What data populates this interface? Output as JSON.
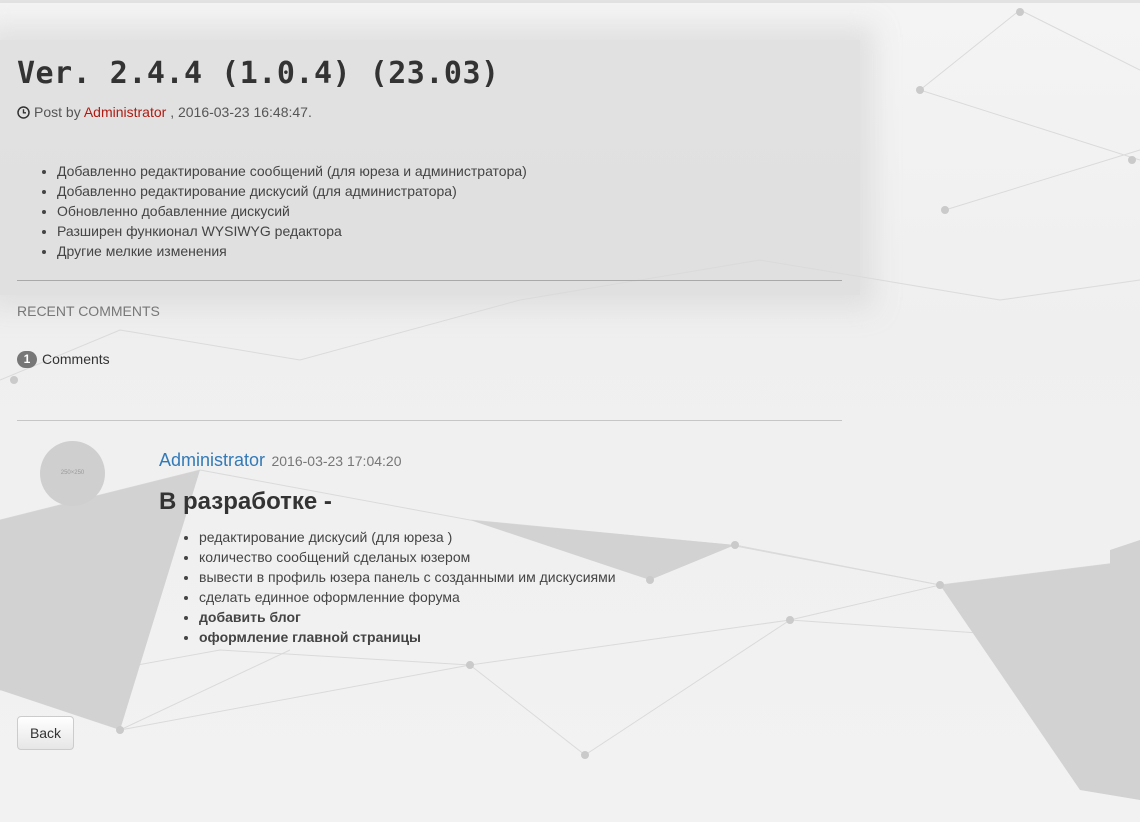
{
  "post": {
    "title": "Ver. 2.4.4 (1.0.4) (23.03)",
    "meta_prefix": "Post by",
    "author": "Administrator",
    "meta_suffix": ", 2016-03-23 16:48:47.",
    "changes": [
      "Добавленно редактирование сообщений (для юреза и администратора)",
      "Добавленно редактирование дискусий (для администратора)",
      "Обновленно добавленние дискусий",
      "Разширен функионал WYSIWYG редактора",
      "Другие мелкие изменения"
    ]
  },
  "comments": {
    "section_label": "RECENT COMMENTS",
    "count": "1",
    "count_label": "Comments",
    "items": [
      {
        "avatar_text": "250×250",
        "author": "Administrator",
        "date": "2016-03-23 17:04:20",
        "title": "В разработке -",
        "list": [
          "редактирование дискусий (для юреза )",
          "количество сообщений сделаных юзером",
          "вывести в профиль юзера панель с созданными им дискусиями",
          "сделать единное оформленние форума",
          "добавить блог",
          "оформление главной страницы"
        ]
      }
    ]
  },
  "back_label": "Back",
  "colors": {
    "author_link": "#b01a12",
    "comment_author": "#337ab7",
    "badge": "#777777"
  },
  "icons": {
    "meta": "clock-icon"
  }
}
